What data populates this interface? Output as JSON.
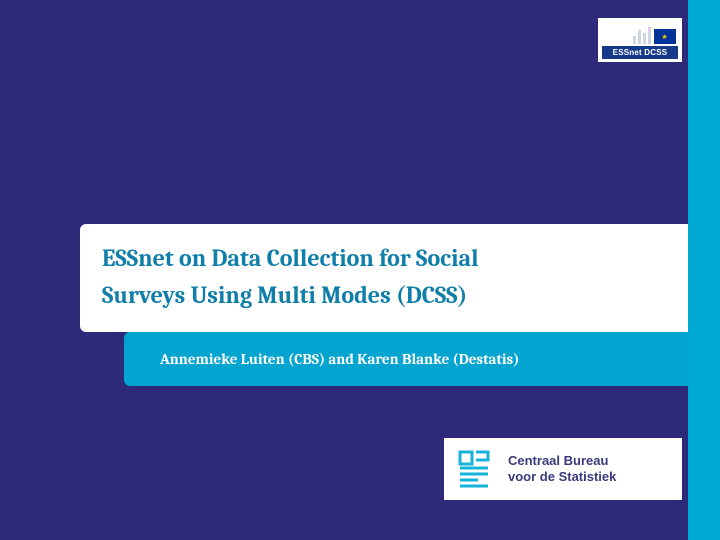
{
  "colors": {
    "background": "#2d2a7a",
    "accent": "#00aad4",
    "title_text": "#0f7ea8",
    "authors_bg": "#03a4cf",
    "cbs_text": "#3b3a7d"
  },
  "essnet_badge": {
    "label": "ESSnet DCSS"
  },
  "title": {
    "line1": "ESSnet on Data Collection for Social",
    "line2": "Surveys Using Multi Modes (DCSS)"
  },
  "authors": "Annemieke Luiten (CBS) and Karen Blanke (Destatis)",
  "cbs_logo": {
    "line1": "Centraal Bureau",
    "line2": "voor de Statistiek"
  }
}
